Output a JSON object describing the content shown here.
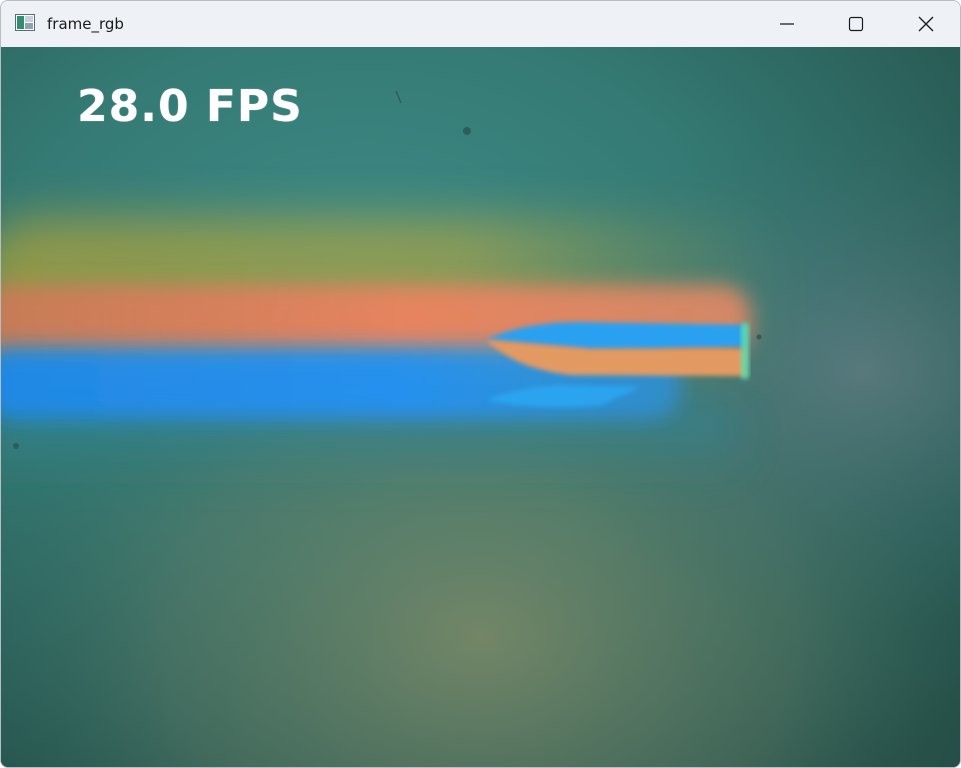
{
  "window": {
    "title": "frame_rgb",
    "controls": {
      "minimize_icon": "minimize-icon",
      "maximize_icon": "maximize-icon",
      "close_icon": "close-icon"
    }
  },
  "overlay": {
    "fps_text": "28.0 FPS"
  },
  "colors": {
    "titlebar_bg": "#eef1f5",
    "frame_base": "#2b5a55",
    "orange_band": "#e6845f",
    "blue_band": "#1f8ef2",
    "yellow_halo": "#a8a84a"
  }
}
